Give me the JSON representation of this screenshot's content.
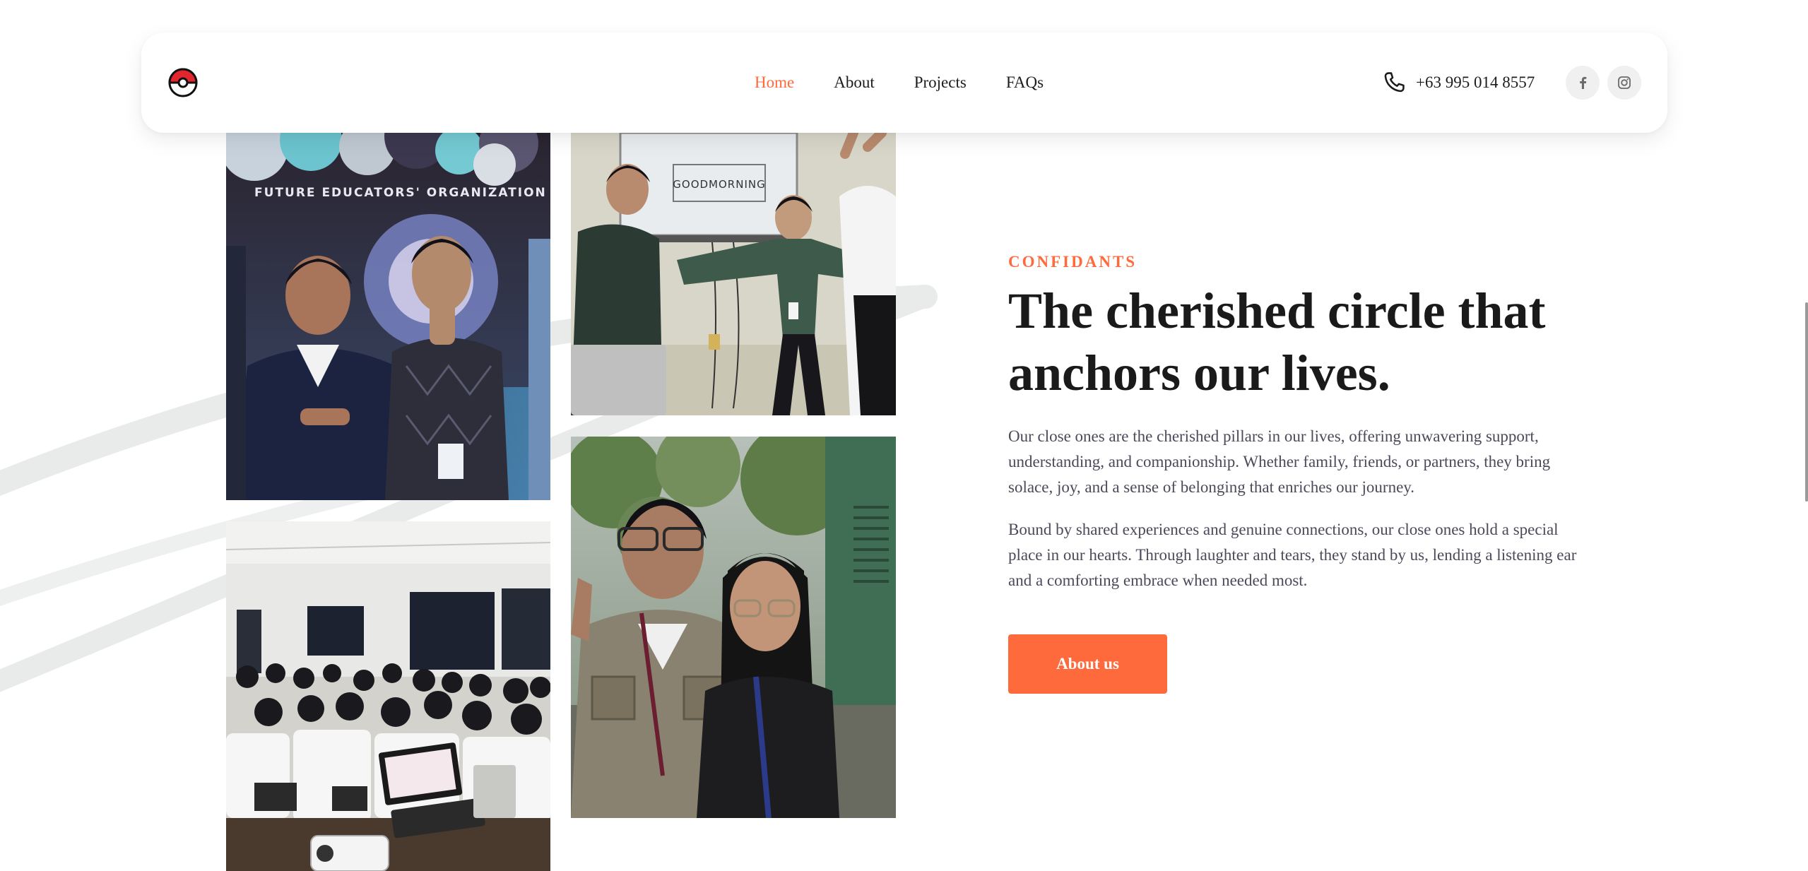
{
  "header": {
    "logo_icon": "pokeball-icon",
    "nav": [
      {
        "label": "Home",
        "active": true
      },
      {
        "label": "About",
        "active": false
      },
      {
        "label": "Projects",
        "active": false
      },
      {
        "label": "FAQs",
        "active": false
      }
    ],
    "phone_icon": "phone-icon",
    "phone": "+63 995 014 8557",
    "social": [
      {
        "icon": "facebook-icon"
      },
      {
        "icon": "instagram-icon"
      }
    ]
  },
  "photos": {
    "banner_text": "FUTURE EDUCATORS' ORGANIZATION",
    "screen_text": "GOODMORNING"
  },
  "section": {
    "eyebrow": "CONFIDANTS",
    "headline": "The cherished circle that anchors our lives.",
    "paragraph_1": "Our close ones are the cherished pillars in our lives, offering unwavering support, understanding, and companionship. Whether family, friends, or partners, they bring solace, joy, and a sense of belonging that enriches our journey.",
    "paragraph_2": "Bound by shared experiences and genuine connections, our close ones hold a special place in our hearts. Through laughter and tears, they stand by us, lending a listening ear and a comforting embrace when needed most.",
    "button_label": "About us"
  },
  "colors": {
    "accent": "#ff6a3d",
    "text_dark": "#1a1a1a",
    "text_body": "#4a4a5a"
  }
}
